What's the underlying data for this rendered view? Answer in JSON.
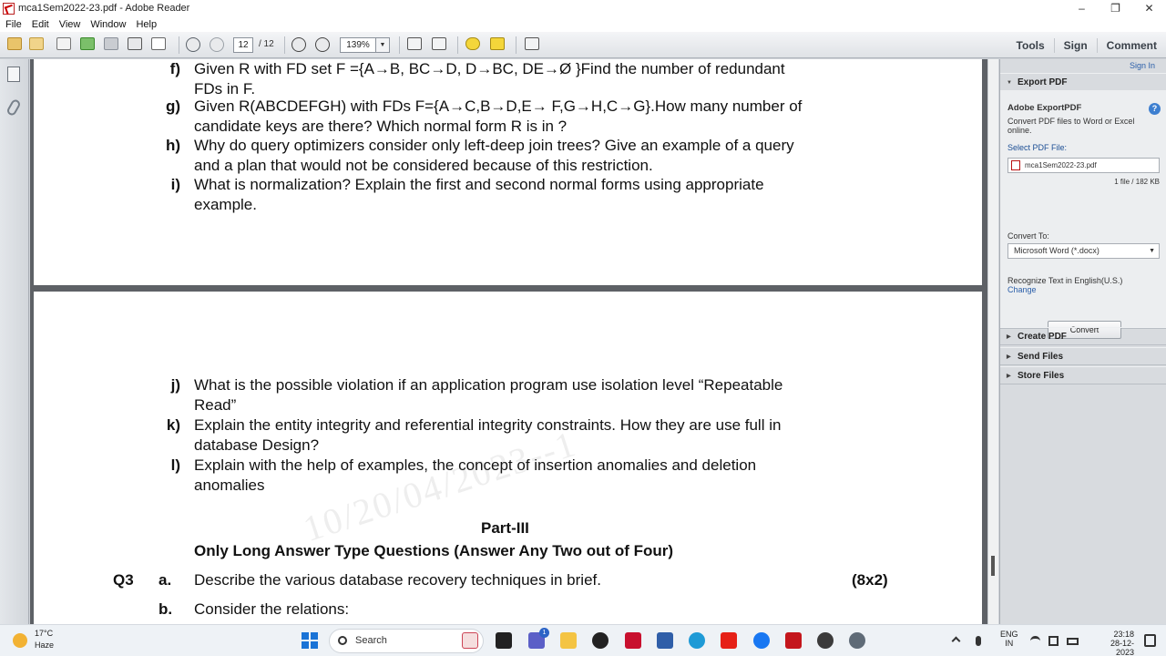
{
  "window": {
    "title": "mca1Sem2022-23.pdf - Adobe Reader",
    "controls": [
      "–",
      "❐",
      "✕"
    ]
  },
  "menu": [
    "File",
    "Edit",
    "View",
    "Window",
    "Help"
  ],
  "toolbar": {
    "page_current": "12",
    "page_total": "/ 12",
    "zoom": "139%",
    "links": [
      "Tools",
      "Sign",
      "Comment"
    ]
  },
  "document": {
    "page1": [
      {
        "label": "f)",
        "text": "Given R with FD set F ={A→B, BC→D, D→BC, DE→Ø }Find the number of redundant FDs in F."
      },
      {
        "label": "g)",
        "text": "Given R(ABCDEFGH) with FDs F={A→C,B→D,E→ F,G→H,C→G}.How many number of candidate keys are there? Which normal form R is in ?"
      },
      {
        "label": "h)",
        "text": "Why do query optimizers consider only left-deep join trees? Give an example of a query and a plan that would not be considered because of this restriction."
      },
      {
        "label": "i)",
        "text": "What is normalization? Explain the first and second normal forms using appropriate example."
      }
    ],
    "page2": [
      {
        "label": "j)",
        "text": "What is the possible violation if an application program use isolation level “Repeatable Read”"
      },
      {
        "label": "k)",
        "text": "Explain the entity integrity and referential integrity constraints. How they are use full in database  Design?"
      },
      {
        "label": "l)",
        "text": "Explain with the help of examples, the concept of insertion anomalies and deletion anomalies"
      }
    ],
    "part_title": "Part-III",
    "part_subtitle": "Only Long Answer Type Questions (Answer Any Two out of Four)",
    "q3_number": "Q3",
    "q3a_label": "a.",
    "q3a_text": "Describe the various database recovery techniques in brief.",
    "q3_marks": "(8x2)",
    "q3b_label": "b.",
    "q3b_text": "Consider the relations:",
    "watermark": "10/20/04/2023--1"
  },
  "right_pane": {
    "sign_in": "Sign In",
    "export_header": "Export PDF",
    "export_title": "Adobe ExportPDF",
    "export_desc_1": "Convert PDF files to Word or Excel",
    "export_desc_2": "online.",
    "select_label": "Select PDF File:",
    "file_name": "mca1Sem2022-23.pdf",
    "file_info": "1 file / 182 KB",
    "convert_to_label": "Convert To:",
    "convert_to_value": "Microsoft Word (*.docx)",
    "recognize_text": "Recognize Text in English(U.S.)",
    "change_link": "Change",
    "convert_button": "Convert",
    "sections": [
      "Create PDF",
      "Send Files",
      "Store Files"
    ]
  },
  "taskbar": {
    "temp": "17°C",
    "weather": "Haze",
    "search": "Search",
    "lang_1": "ENG",
    "lang_2": "IN",
    "time": "23:18",
    "date": "28-12-2023",
    "badge": "1"
  }
}
